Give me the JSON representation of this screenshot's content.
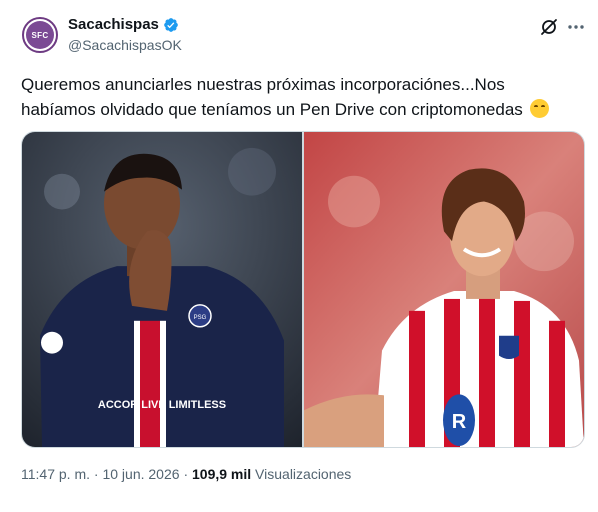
{
  "author": {
    "display_name": "Sacachispas",
    "handle": "@SacachispasOK",
    "avatar_initials": "SFC",
    "verified": true
  },
  "tweet": {
    "text": "Queremos anunciarles nuestras próximas incorporaciónes...Nos habíamos olvidado que teníamos un Pen Drive con criptomonedas",
    "emoji": "face-with-tears-of-joy"
  },
  "media": {
    "left_photo": {
      "jersey_text": "ACCOR LIVE LIMITLESS",
      "badge_text": "PSG"
    },
    "right_photo": {
      "badge_text": "R"
    }
  },
  "footer": {
    "time": "11:47 p. m.",
    "separator": "·",
    "date": "10 jun. 2026",
    "views_count": "109,9 mil",
    "views_label": "Visualizaciones"
  },
  "icons": {
    "grok": "grok-icon",
    "more": "more-icon",
    "verified": "verified-badge-icon"
  },
  "colors": {
    "text": "#0f1419",
    "secondary": "#536471",
    "verified": "#1d9bf0",
    "avatar": "#7b4a94"
  }
}
